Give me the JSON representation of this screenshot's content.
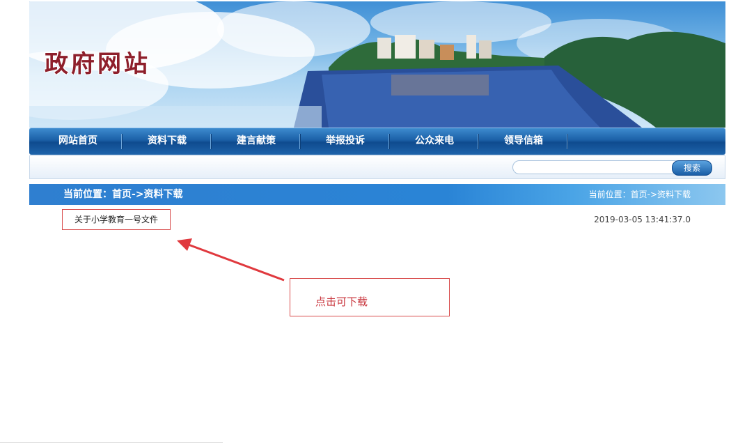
{
  "header": {
    "site_title": "政府网站"
  },
  "nav": {
    "items": [
      {
        "label": "网站首页"
      },
      {
        "label": "资料下载"
      },
      {
        "label": "建言献策"
      },
      {
        "label": "举报投诉"
      },
      {
        "label": "公众来电"
      },
      {
        "label": "领导信箱"
      }
    ]
  },
  "search": {
    "placeholder": "",
    "button_label": "搜索"
  },
  "location": {
    "left_text": "当前位置：首页->资料下载",
    "right_text": "当前位置：首页->资料下载"
  },
  "documents": [
    {
      "title": "关于小学教育一号文件",
      "date": "2019-03-05 13:41:37.0"
    }
  ],
  "annotation": {
    "text": "点击可下载",
    "color": "#d84a4a"
  },
  "colors": {
    "title_red": "#8e1f2b",
    "nav_blue": "#1c61a8",
    "location_blue": "#2f7fd0",
    "annotation_red": "#d84a4a"
  }
}
